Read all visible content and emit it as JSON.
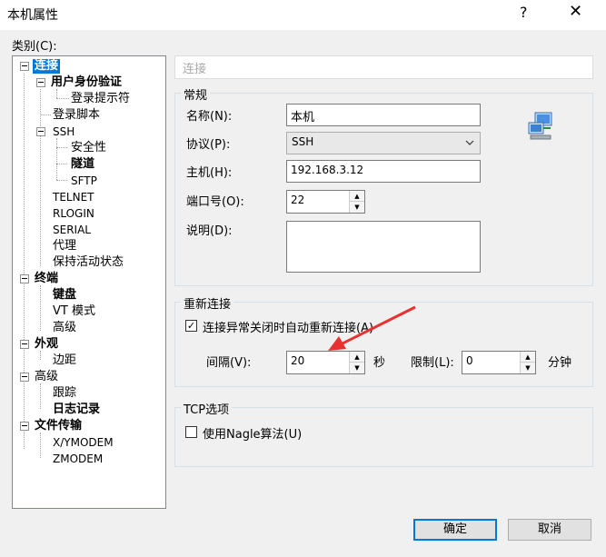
{
  "window": {
    "title": "本机属性",
    "help_glyph": "?",
    "close_glyph": "✕"
  },
  "category_label": "类别(C):",
  "tree": [
    {
      "label": "连接",
      "selected": true,
      "bold": true
    },
    {
      "label": "用户身份验证",
      "bold": true
    },
    {
      "label": "登录提示符"
    },
    {
      "label": "登录脚本"
    },
    {
      "label": "SSH"
    },
    {
      "label": "安全性"
    },
    {
      "label": "隧道",
      "bold": true
    },
    {
      "label": "SFTP"
    },
    {
      "label": "TELNET"
    },
    {
      "label": "RLOGIN"
    },
    {
      "label": "SERIAL"
    },
    {
      "label": "代理"
    },
    {
      "label": "保持活动状态"
    },
    {
      "label": "终端",
      "bold": true
    },
    {
      "label": "键盘",
      "bold": true
    },
    {
      "label": "VT 模式"
    },
    {
      "label": "高级"
    },
    {
      "label": "外观",
      "bold": true
    },
    {
      "label": "边距"
    },
    {
      "label": "高级"
    },
    {
      "label": "跟踪"
    },
    {
      "label": "日志记录",
      "bold": true
    },
    {
      "label": "文件传输",
      "bold": true
    },
    {
      "label": "X/YMODEM"
    },
    {
      "label": "ZMODEM"
    }
  ],
  "section_title": "连接",
  "general": {
    "title": "常规",
    "name_label": "名称(N):",
    "name_value": "本机",
    "protocol_label": "协议(P):",
    "protocol_value": "SSH",
    "host_label": "主机(H):",
    "host_value": "192.168.3.12",
    "port_label": "端口号(O):",
    "port_value": "22",
    "desc_label": "说明(D):",
    "desc_value": ""
  },
  "reconnect": {
    "title": "重新连接",
    "auto_label": "连接异常关闭时自动重新连接(A)",
    "auto_checked": true,
    "interval_label": "间隔(V):",
    "interval_value": "20",
    "interval_unit": "秒",
    "limit_label": "限制(L):",
    "limit_value": "0",
    "limit_unit": "分钟"
  },
  "tcp": {
    "title": "TCP选项",
    "nagle_label": "使用Nagle算法(U)",
    "nagle_checked": false
  },
  "buttons": {
    "ok": "确定",
    "cancel": "取消"
  },
  "colors": {
    "selection": "#0078d7",
    "annotation_arrow": "#e8322f"
  }
}
